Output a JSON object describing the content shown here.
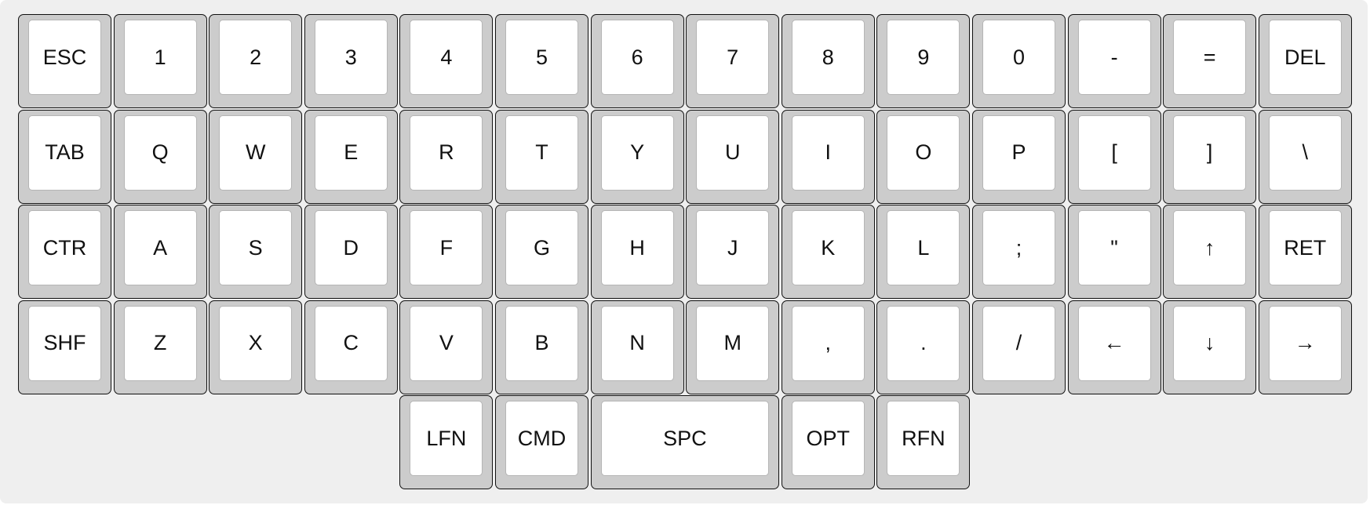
{
  "keyboard": {
    "rows": [
      [
        {
          "name": "key-esc",
          "label": "ESC"
        },
        {
          "name": "key-1",
          "label": "1"
        },
        {
          "name": "key-2",
          "label": "2"
        },
        {
          "name": "key-3",
          "label": "3"
        },
        {
          "name": "key-4",
          "label": "4"
        },
        {
          "name": "key-5",
          "label": "5"
        },
        {
          "name": "key-6",
          "label": "6"
        },
        {
          "name": "key-7",
          "label": "7"
        },
        {
          "name": "key-8",
          "label": "8"
        },
        {
          "name": "key-9",
          "label": "9"
        },
        {
          "name": "key-0",
          "label": "0"
        },
        {
          "name": "key-minus",
          "label": "-"
        },
        {
          "name": "key-equals",
          "label": "="
        },
        {
          "name": "key-del",
          "label": "DEL"
        }
      ],
      [
        {
          "name": "key-tab",
          "label": "TAB"
        },
        {
          "name": "key-q",
          "label": "Q"
        },
        {
          "name": "key-w",
          "label": "W"
        },
        {
          "name": "key-e",
          "label": "E"
        },
        {
          "name": "key-r",
          "label": "R"
        },
        {
          "name": "key-t",
          "label": "T"
        },
        {
          "name": "key-y",
          "label": "Y"
        },
        {
          "name": "key-u",
          "label": "U"
        },
        {
          "name": "key-i",
          "label": "I"
        },
        {
          "name": "key-o",
          "label": "O"
        },
        {
          "name": "key-p",
          "label": "P"
        },
        {
          "name": "key-left-bracket",
          "label": "["
        },
        {
          "name": "key-right-bracket",
          "label": "]"
        },
        {
          "name": "key-backslash",
          "label": "\\"
        }
      ],
      [
        {
          "name": "key-ctr",
          "label": "CTR"
        },
        {
          "name": "key-a",
          "label": "A"
        },
        {
          "name": "key-s",
          "label": "S"
        },
        {
          "name": "key-d",
          "label": "D"
        },
        {
          "name": "key-f",
          "label": "F"
        },
        {
          "name": "key-g",
          "label": "G"
        },
        {
          "name": "key-h",
          "label": "H"
        },
        {
          "name": "key-j",
          "label": "J"
        },
        {
          "name": "key-k",
          "label": "K"
        },
        {
          "name": "key-l",
          "label": "L"
        },
        {
          "name": "key-semicolon",
          "label": ";"
        },
        {
          "name": "key-quote",
          "label": "\""
        },
        {
          "name": "key-arrow-up",
          "label": "↑"
        },
        {
          "name": "key-ret",
          "label": "RET"
        }
      ],
      [
        {
          "name": "key-shf",
          "label": "SHF"
        },
        {
          "name": "key-z",
          "label": "Z"
        },
        {
          "name": "key-x",
          "label": "X"
        },
        {
          "name": "key-c",
          "label": "C"
        },
        {
          "name": "key-v",
          "label": "V"
        },
        {
          "name": "key-b",
          "label": "B"
        },
        {
          "name": "key-n",
          "label": "N"
        },
        {
          "name": "key-m",
          "label": "M"
        },
        {
          "name": "key-comma",
          "label": ","
        },
        {
          "name": "key-period",
          "label": "."
        },
        {
          "name": "key-slash",
          "label": "/"
        },
        {
          "name": "key-arrow-left",
          "label": "←"
        },
        {
          "name": "key-arrow-down",
          "label": "↓"
        },
        {
          "name": "key-arrow-right",
          "label": "→"
        }
      ],
      [
        {
          "name": "key-lfn",
          "label": "LFN",
          "col": 4
        },
        {
          "name": "key-cmd",
          "label": "CMD",
          "col": 5
        },
        {
          "name": "key-spc",
          "label": "SPC",
          "col": 6,
          "span": 2
        },
        {
          "name": "key-opt",
          "label": "OPT",
          "col": 8
        },
        {
          "name": "key-rfn",
          "label": "RFN",
          "col": 9
        }
      ]
    ]
  }
}
